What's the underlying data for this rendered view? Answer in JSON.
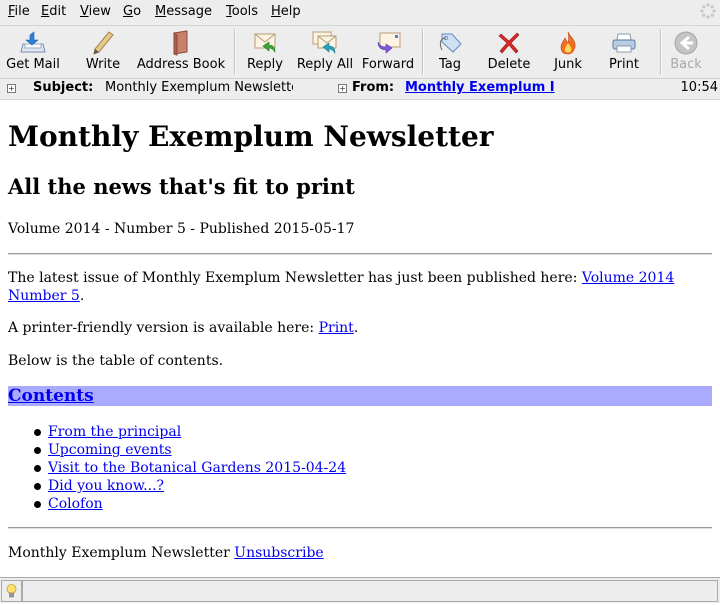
{
  "menubar": {
    "items": [
      {
        "label": "File",
        "key": "F",
        "rest": "ile"
      },
      {
        "label": "Edit",
        "key": "E",
        "rest": "dit"
      },
      {
        "label": "View",
        "key": "V",
        "rest": "iew"
      },
      {
        "label": "Go",
        "key": "G",
        "rest": "o"
      },
      {
        "label": "Message",
        "key": "M",
        "rest": "essage"
      },
      {
        "label": "Tools",
        "key": "T",
        "rest": "ools"
      },
      {
        "label": "Help",
        "key": "H",
        "rest": "elp"
      }
    ]
  },
  "toolbar": {
    "get_mail": "Get Mail",
    "write": "Write",
    "address_book": "Address Book",
    "reply": "Reply",
    "reply_all": "Reply All",
    "forward": "Forward",
    "tag": "Tag",
    "delete": "Delete",
    "junk": "Junk",
    "print": "Print",
    "back": "Back"
  },
  "header": {
    "subject_label": "Subject:",
    "subject_value": "Monthly Exemplum Newslette",
    "from_label": "From:",
    "from_value": "Monthly Exemplum I",
    "time": "10:54"
  },
  "message": {
    "title": "Monthly Exemplum Newsletter",
    "subtitle": "All the news that's fit to print",
    "volume_line": "Volume 2014 - Number 5 - Published 2015-05-17",
    "intro_text": "The latest issue of Monthly Exemplum Newsletter has just been published here: ",
    "intro_link_1": "Volume 2014",
    "intro_link_2": "Number 5",
    "intro_end": ".",
    "print_text": "A printer-friendly version is available here: ",
    "print_link": "Print",
    "print_end": ".",
    "toc_intro": "Below is the table of contents.",
    "contents_heading": "Contents",
    "toc": [
      "From the principal",
      "Upcoming events",
      "Visit to the Botanical Gardens 2015-04-24",
      "Did you know...?",
      "Colofon"
    ],
    "footer_text": "Monthly Exemplum Newsletter ",
    "footer_link": "Unsubscribe"
  },
  "colors": {
    "contents_bg": "#aaaaff",
    "link": "#0000ee"
  }
}
